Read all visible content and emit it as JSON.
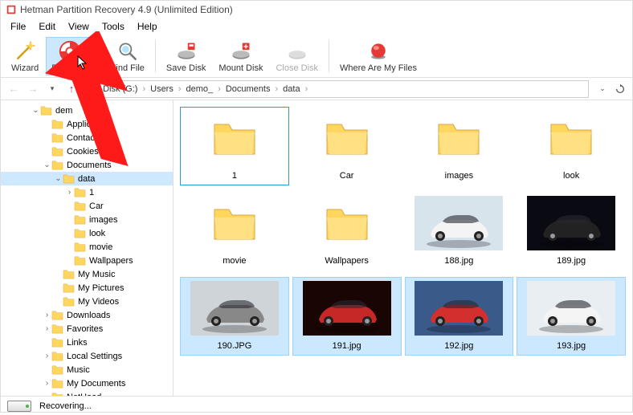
{
  "window_title": "Hetman Partition Recovery 4.9 (Unlimited Edition)",
  "menu": [
    "File",
    "Edit",
    "View",
    "Tools",
    "Help"
  ],
  "toolbar": {
    "wizard": "Wizard",
    "recovery": "Recovery",
    "find": "Find File",
    "save": "Save Disk",
    "mount": "Mount Disk",
    "close": "Close Disk",
    "where": "Where Are My Files"
  },
  "breadcrumb": [
    "Disk (G:)",
    "Users",
    "demo_",
    "Documents",
    "data"
  ],
  "tree": [
    {
      "level": 2,
      "exp": "v",
      "label": "dem",
      "folder": true
    },
    {
      "level": 3,
      "exp": "",
      "label": "Applicat",
      "folder": true
    },
    {
      "level": 3,
      "exp": "",
      "label": "Contacts",
      "folder": true
    },
    {
      "level": 3,
      "exp": "",
      "label": "Cookies",
      "folder": true
    },
    {
      "level": 3,
      "exp": "v",
      "label": "Documents",
      "folder": true
    },
    {
      "level": 4,
      "exp": "v",
      "label": "data",
      "folder": true,
      "selected": true
    },
    {
      "level": 5,
      "exp": ">",
      "label": "1",
      "folder": true
    },
    {
      "level": 5,
      "exp": "",
      "label": "Car",
      "folder": true
    },
    {
      "level": 5,
      "exp": "",
      "label": "images",
      "folder": true
    },
    {
      "level": 5,
      "exp": "",
      "label": "look",
      "folder": true
    },
    {
      "level": 5,
      "exp": "",
      "label": "movie",
      "folder": true
    },
    {
      "level": 5,
      "exp": "",
      "label": "Wallpapers",
      "folder": true
    },
    {
      "level": 4,
      "exp": "",
      "label": "My Music",
      "folder": true
    },
    {
      "level": 4,
      "exp": "",
      "label": "My Pictures",
      "folder": true
    },
    {
      "level": 4,
      "exp": "",
      "label": "My Videos",
      "folder": true
    },
    {
      "level": 3,
      "exp": ">",
      "label": "Downloads",
      "folder": true
    },
    {
      "level": 3,
      "exp": ">",
      "label": "Favorites",
      "folder": true
    },
    {
      "level": 3,
      "exp": "",
      "label": "Links",
      "folder": true
    },
    {
      "level": 3,
      "exp": ">",
      "label": "Local Settings",
      "folder": true
    },
    {
      "level": 3,
      "exp": "",
      "label": "Music",
      "folder": true
    },
    {
      "level": 3,
      "exp": ">",
      "label": "My Documents",
      "folder": true
    },
    {
      "level": 3,
      "exp": "",
      "label": "NetHood",
      "folder": true
    }
  ],
  "tiles": [
    {
      "type": "folder",
      "label": "1",
      "first_sel": true
    },
    {
      "type": "folder",
      "label": "Car"
    },
    {
      "type": "folder",
      "label": "images"
    },
    {
      "type": "folder",
      "label": "look"
    },
    {
      "type": "folder",
      "label": "movie"
    },
    {
      "type": "folder",
      "label": "Wallpapers"
    },
    {
      "type": "image",
      "label": "188.jpg",
      "car": "white-front"
    },
    {
      "type": "image",
      "label": "189.jpg",
      "car": "black-side"
    },
    {
      "type": "image",
      "label": "190.JPG",
      "car": "gray-front",
      "selected": true
    },
    {
      "type": "image",
      "label": "191.jpg",
      "car": "red-dark",
      "selected": true
    },
    {
      "type": "image",
      "label": "192.jpg",
      "car": "red-blue",
      "selected": true
    },
    {
      "type": "image",
      "label": "193.jpg",
      "car": "white-side",
      "selected": true
    }
  ],
  "status": "Recovering..."
}
